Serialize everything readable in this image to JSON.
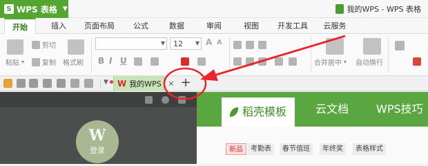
{
  "app": {
    "name": "WPS 表格",
    "logo": "S"
  },
  "window": {
    "title": "我的WPS - WPS 表格"
  },
  "tabs": [
    {
      "label": "开始",
      "active": true
    },
    {
      "label": "插入"
    },
    {
      "label": "页面布局"
    },
    {
      "label": "公式"
    },
    {
      "label": "数据"
    },
    {
      "label": "审阅"
    },
    {
      "label": "视图"
    },
    {
      "label": "开发工具"
    },
    {
      "label": "云服务"
    }
  ],
  "ribbon": {
    "paste": "粘贴",
    "cut": "剪切",
    "copy": "复制",
    "format_painter": "格式刷",
    "font_size": "12",
    "bold": "B",
    "italic": "I",
    "underline": "U",
    "font_grow": "A",
    "font_shrink": "A",
    "merge_center": "合并居中",
    "wrap_text": "自动换行"
  },
  "doc_tab": {
    "logo": "W",
    "name": "我的WPS",
    "close": "×",
    "add": "+"
  },
  "left_panel": {
    "login": "登录",
    "avatar_mark": "W"
  },
  "right_panel": {
    "tabs": [
      {
        "label": "稻壳模板",
        "active": true
      },
      {
        "label": "云文档"
      },
      {
        "label": "WPS技巧"
      }
    ],
    "tags": [
      "新品",
      "考勤表",
      "春节值班",
      "年终奖",
      "表格样式"
    ]
  },
  "colors": {
    "brand": "#55a532",
    "annotation": "#e8262b"
  }
}
